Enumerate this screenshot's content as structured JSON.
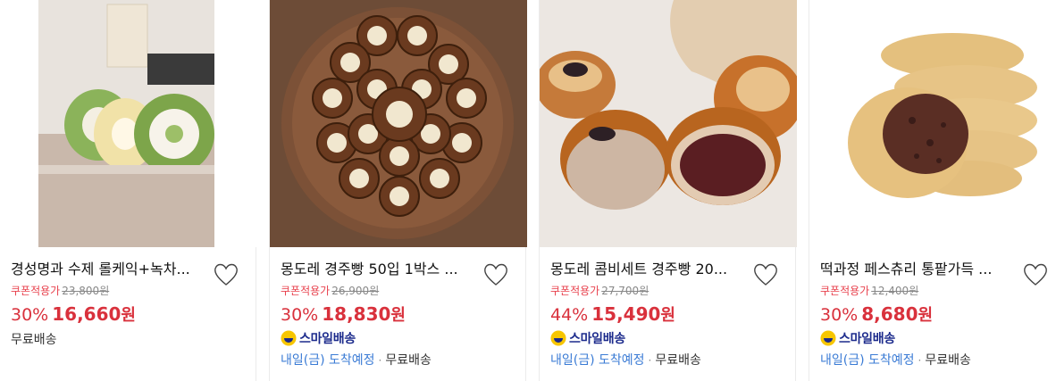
{
  "colors": {
    "accent_red": "#d9313c",
    "coupon_red": "#e8424e",
    "smile_blue": "#1c2b8c",
    "arrival_blue": "#3a7bd5",
    "smile_yellow": "#f7c600"
  },
  "products": [
    {
      "title": "경성명과 수제 롤케익+녹차...",
      "image": "roll-cake-photo",
      "coupon_label": "쿠폰적용가",
      "original_price": "23,800원",
      "discount": "30%",
      "price": "16,660",
      "currency": "원",
      "shipping": "무료배송"
    },
    {
      "title": "몽도레 경주빵 50입 1박스 ...",
      "image": "gyeongju-bread-platter-photo",
      "coupon_label": "쿠폰적용가",
      "original_price": "26,900원",
      "discount": "30%",
      "price": "18,830",
      "currency": "원",
      "smile_delivery": "스마일배송",
      "arrival": "내일(금) 도착예정",
      "shipping": "무료배송"
    },
    {
      "title": "몽도레 콤비세트 경주빵 20...",
      "image": "combi-bread-photo",
      "coupon_label": "쿠폰적용가",
      "original_price": "27,700원",
      "discount": "44%",
      "price": "15,490",
      "currency": "원",
      "smile_delivery": "스마일배송",
      "arrival": "내일(금) 도착예정",
      "shipping": "무료배송"
    },
    {
      "title": "떡과정 페스츄리 통팥가득 ...",
      "image": "pastry-red-bean-photo",
      "coupon_label": "쿠폰적용가",
      "original_price": "12,400원",
      "discount": "30%",
      "price": "8,680",
      "currency": "원",
      "smile_delivery": "스마일배송",
      "arrival": "내일(금) 도착예정",
      "shipping": "무료배송"
    }
  ]
}
